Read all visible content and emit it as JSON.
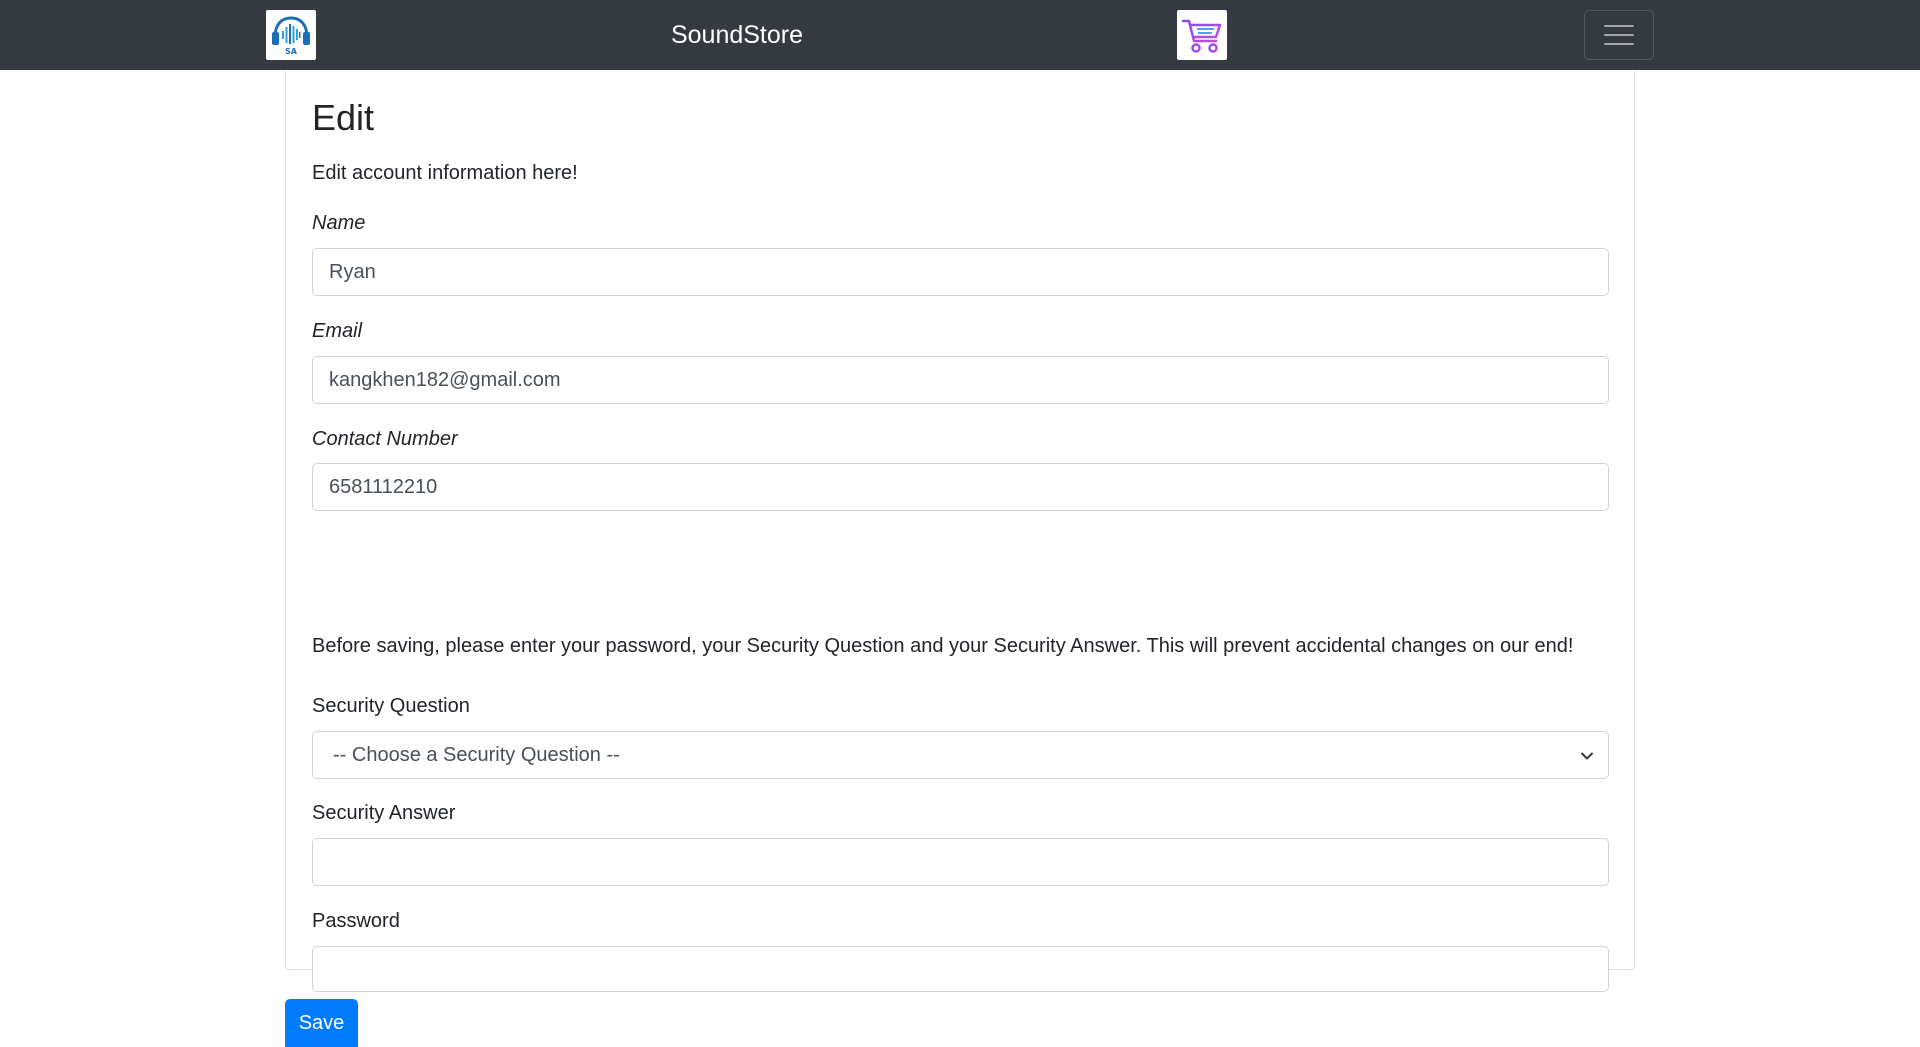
{
  "navbar": {
    "brand": "SoundStore",
    "logo_icon": "headphones-soundwave-logo",
    "logo_text": "SA",
    "cart_icon": "shopping-cart-icon",
    "menu_icon": "hamburger-menu-icon",
    "background_color": "#343a40"
  },
  "form": {
    "title": "Edit",
    "subtitle": "Edit account information here!",
    "name": {
      "label": "Name",
      "value": "Ryan"
    },
    "email": {
      "label": "Email",
      "value": "kangkhen182@gmail.com"
    },
    "contact": {
      "label": "Contact Number",
      "value": "6581112210"
    },
    "notice": "Before saving, please enter your password, your Security Question and your Security Answer. This will prevent accidental changes on our end!",
    "security_question": {
      "label": "Security Question",
      "selected": "-- Choose a Security Question --"
    },
    "security_answer": {
      "label": "Security Answer",
      "value": ""
    },
    "password": {
      "label": "Password",
      "value": ""
    }
  },
  "actions": {
    "save_label": "Save",
    "save_color": "#007bff"
  }
}
